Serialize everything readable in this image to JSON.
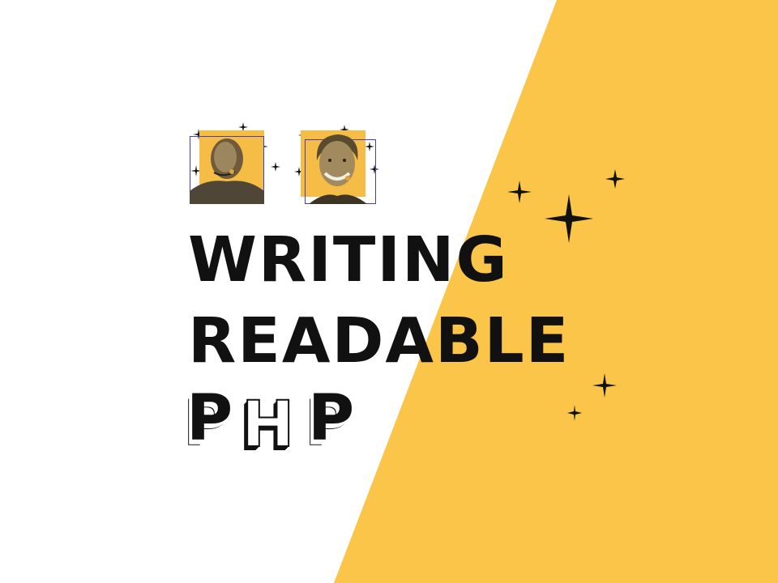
{
  "title": {
    "line1": "WRITING",
    "line2": "READABLE",
    "line3_letters": [
      "P",
      "H",
      "P"
    ]
  },
  "colors": {
    "background": "#ffffff",
    "accent_yellow": "#fbc54a",
    "photo_tint": "#f5bd45",
    "frame": "#4b3fb0",
    "text": "#111111"
  },
  "decorations": {
    "sparkle_icon": "four-point-star"
  }
}
